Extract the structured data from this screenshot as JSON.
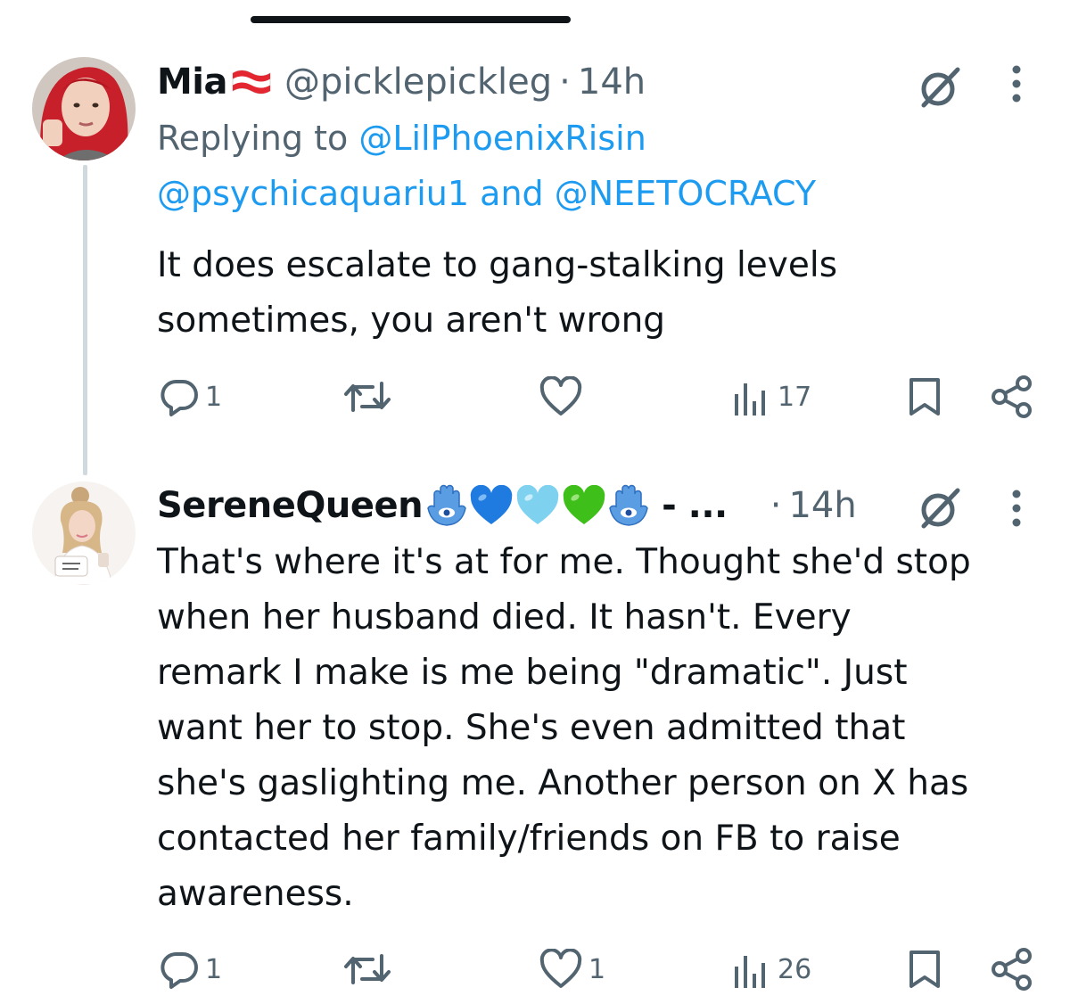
{
  "tweets": [
    {
      "name": "Mia",
      "handle": "@picklepickleg",
      "separator": "·",
      "time": "14h",
      "replying_prefix": "Replying to",
      "reply_mention_1": "@LilPhoenixRisin",
      "reply_mention_2": "@psychicaquariu1",
      "reply_conjunction": "and",
      "reply_mention_3": "@NEETOCRACY",
      "text": "It does escalate to gang-stalking levels\nsometimes, you aren't wrong",
      "actions": {
        "replies": "1",
        "retweets": "",
        "likes": "",
        "views": "17"
      },
      "name_emoji": "austria-flag"
    },
    {
      "name": "SereneQueen",
      "handle_truncated": "- ...",
      "separator": "·",
      "time": "14h",
      "text": "That's where it's at for me. Thought she'd stop\nwhen her husband died. It hasn't. Every\nremark I make is me being \"dramatic\". Just\nwant her to stop. She's even admitted that\nshe's gaslighting me. Another person on X has\ncontacted her family/friends on FB to raise\nawareness.",
      "actions": {
        "replies": "1",
        "retweets": "",
        "likes": "1",
        "views": "26"
      },
      "name_emojis": [
        "hamsa-icon",
        "blue-heart-icon",
        "light-blue-heart-icon",
        "green-heart-icon",
        "hamsa-icon"
      ]
    }
  ],
  "colors": {
    "text": "#0f1419",
    "secondary": "#536471",
    "link": "#1d9bf0",
    "thread_line": "#cfd9de"
  }
}
